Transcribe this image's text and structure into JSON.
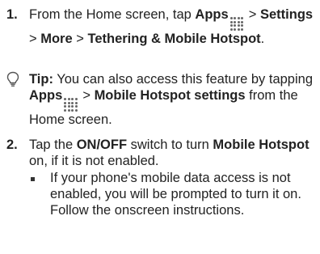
{
  "step1": {
    "number": "1.",
    "line1_a": "From the Home screen, tap ",
    "apps": "Apps",
    "sep1": " > ",
    "settings": "Settings",
    "sep2": " > ",
    "more": "More",
    "sep3": " > ",
    "tethering": "Tethering & Mobile Hotspot",
    "end": "."
  },
  "tip": {
    "label": "Tip:",
    "text_a": " You can also access this feature by tapping ",
    "apps": "Apps",
    "sep": " > ",
    "hotspot_settings": "Mobile Hotspot settings",
    "text_b": " from the Home screen.",
    "icon": "lightbulb-icon"
  },
  "step2": {
    "number": "2.",
    "text_a": "Tap the ",
    "onoff": "ON/OFF",
    "text_b": " switch to turn ",
    "mobile_hotspot": "Mobile Hotspot",
    "text_c": " on, if it is not enabled."
  },
  "bullet": {
    "text": "If your phone's mobile data access is not enabled, you will be prompted to turn it on. Follow the onscreen instructions."
  }
}
